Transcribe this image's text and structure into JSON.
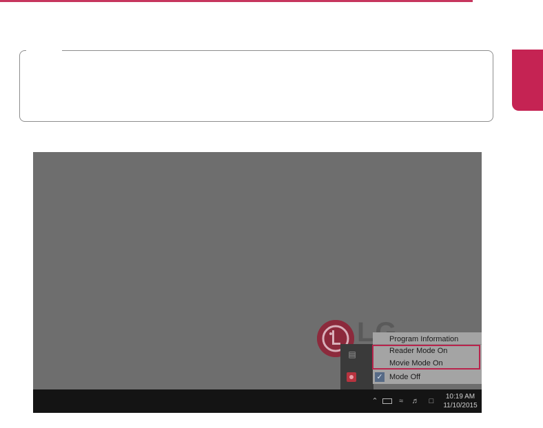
{
  "context_menu": {
    "items": [
      {
        "label": "Program Information",
        "checked": false
      },
      {
        "label": "Reader Mode On",
        "checked": false
      },
      {
        "label": "Movie Mode On",
        "checked": false
      },
      {
        "label": "Mode Off",
        "checked": true
      }
    ]
  },
  "taskbar": {
    "time": "10:19 AM",
    "date": "11/10/2015",
    "icons": [
      "chevron-up-icon",
      "battery-icon",
      "wifi-icon",
      "volume-icon",
      "action-center-icon"
    ]
  },
  "desktop": {
    "wordmark": "LG"
  },
  "colors": {
    "accent": "#c52353",
    "highlight": "#b8244c",
    "desktop_bg": "#6e6e6e",
    "taskbar_bg": "#141414"
  }
}
